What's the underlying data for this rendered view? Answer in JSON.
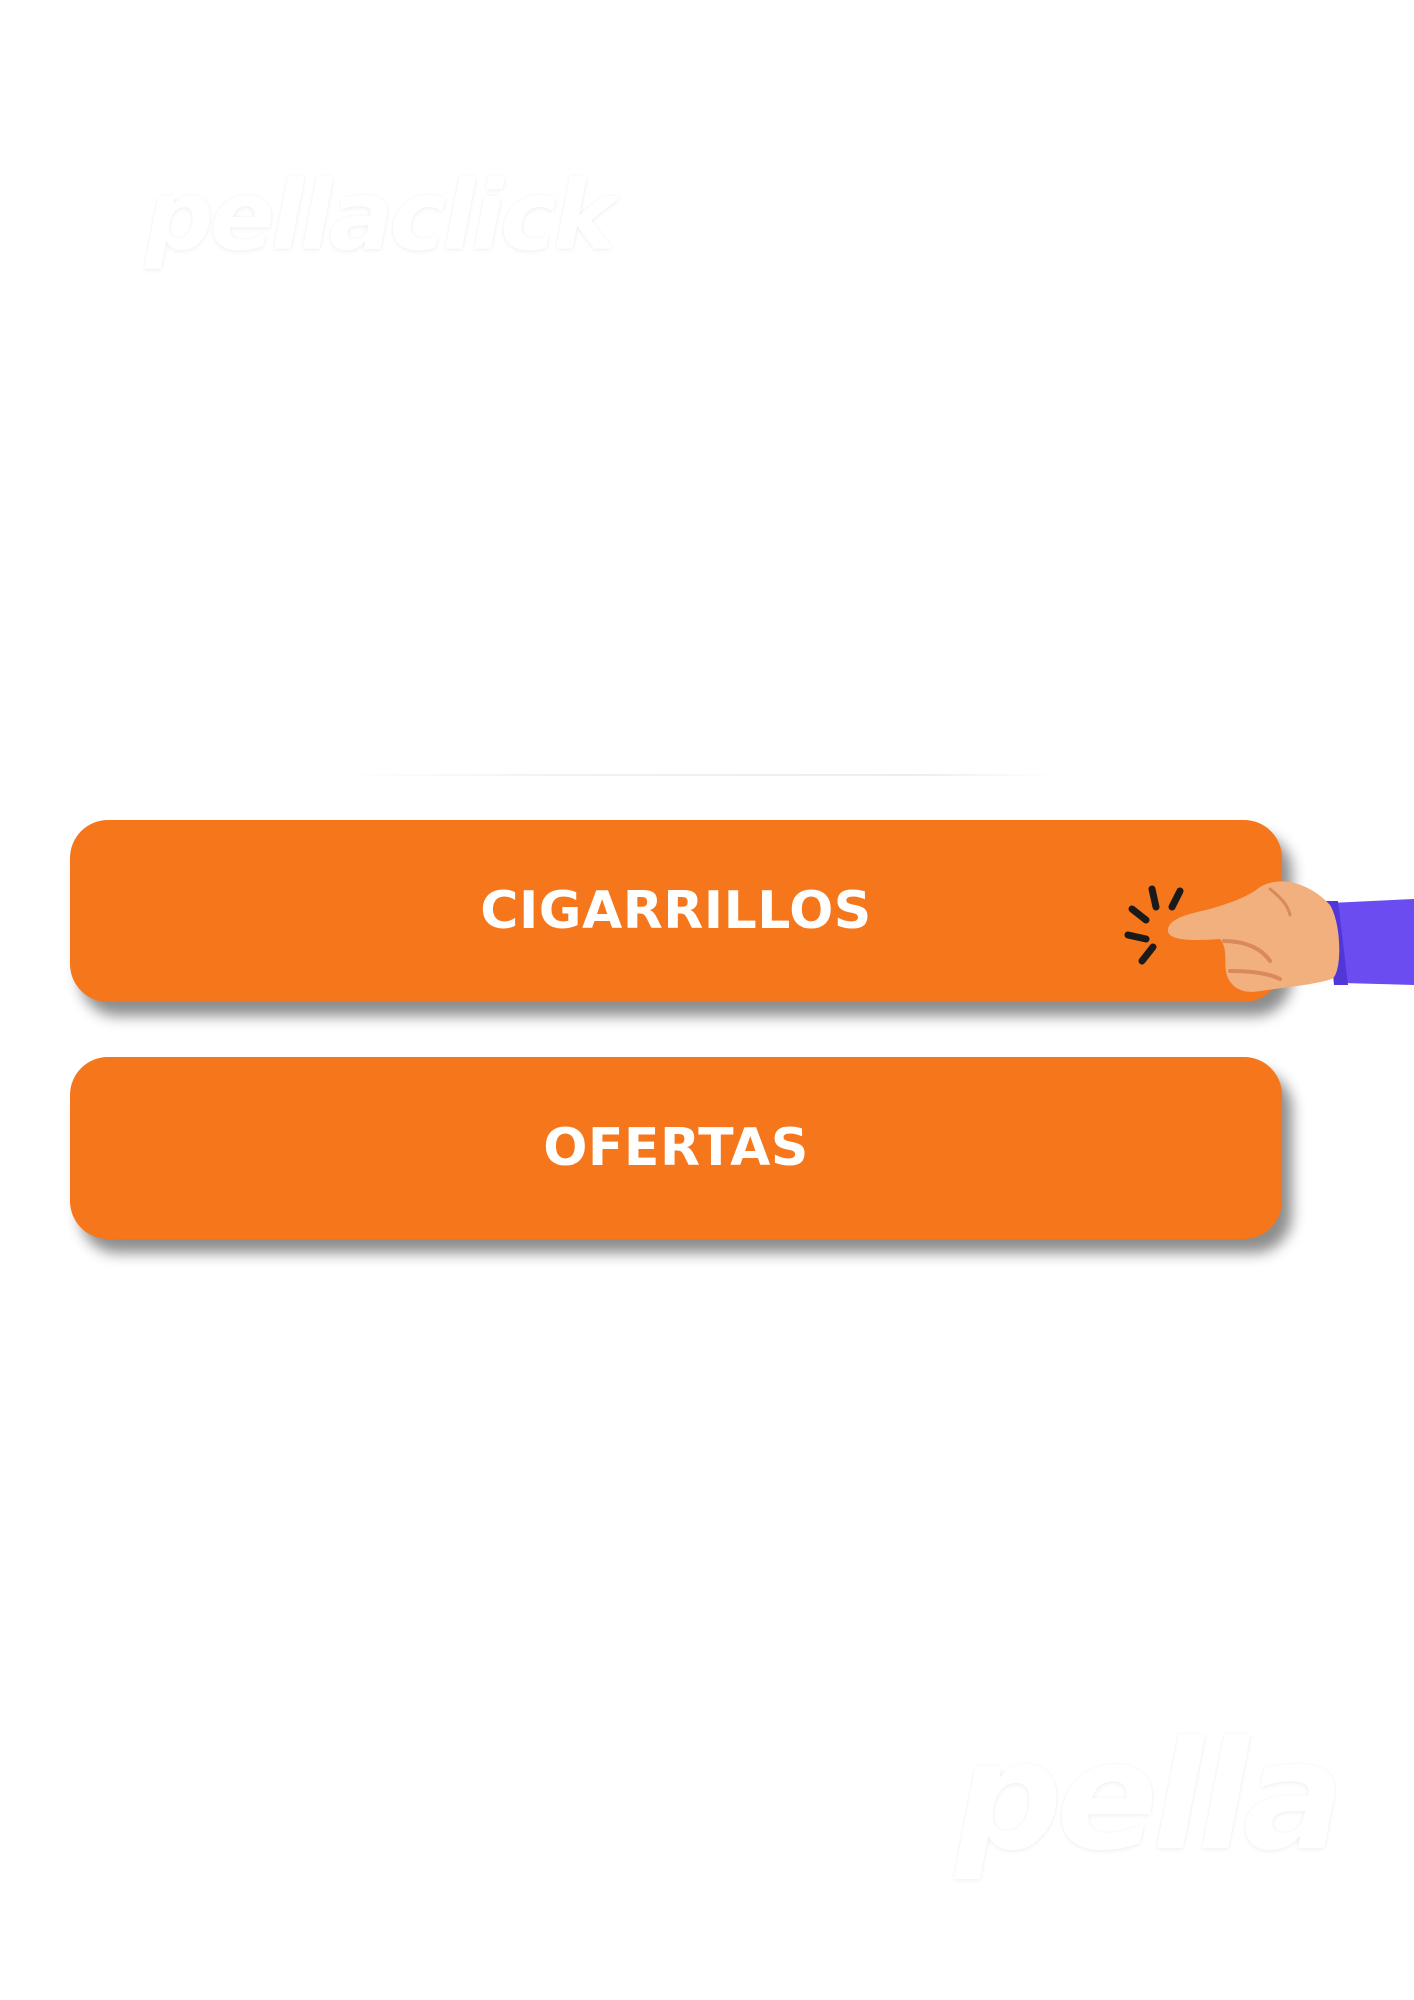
{
  "brand": {
    "top_logo": "pellaclick",
    "bottom_logo": "pella"
  },
  "menu": {
    "buttons": [
      {
        "label": "CIGARRILLOS"
      },
      {
        "label": "OFERTAS"
      }
    ]
  },
  "icons": {
    "pointer": "hand-pointer-icon",
    "click_burst": "click-burst-icon"
  },
  "colors": {
    "button_bg": "#f5761b",
    "button_text": "#ffffff",
    "background": "#ffffff",
    "sleeve": "#6a4cf0",
    "skin": "#f2b07f"
  }
}
